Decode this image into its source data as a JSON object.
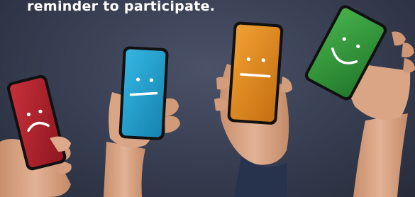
{
  "caption": "reminder to participate.",
  "phones": [
    {
      "mood": "sad",
      "screen_color": "#b0212a"
    },
    {
      "mood": "neutral",
      "screen_color": "#1e9fcc"
    },
    {
      "mood": "neutral",
      "screen_color": "#e0891b"
    },
    {
      "mood": "happy",
      "screen_color": "#2f9a3a"
    }
  ],
  "colors": {
    "background": "#3a4155",
    "skin": "#d9a585",
    "sleeve": "#2a3550"
  }
}
